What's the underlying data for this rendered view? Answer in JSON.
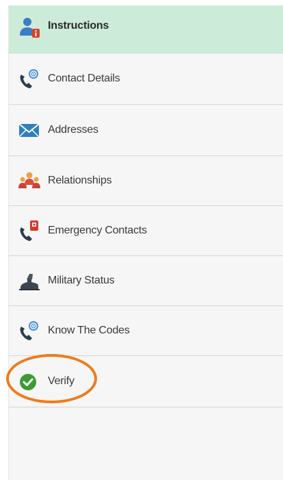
{
  "nav": {
    "items": [
      {
        "label": "Instructions",
        "icon": "user-info-icon",
        "active": true
      },
      {
        "label": "Contact Details",
        "icon": "phone-email-icon",
        "active": false
      },
      {
        "label": "Addresses",
        "icon": "envelope-icon",
        "active": false
      },
      {
        "label": "Relationships",
        "icon": "people-group-icon",
        "active": false
      },
      {
        "label": "Emergency Contacts",
        "icon": "emergency-phone-icon",
        "active": false
      },
      {
        "label": "Military Status",
        "icon": "military-icon",
        "active": false
      },
      {
        "label": "Know The Codes",
        "icon": "phone-email-icon",
        "active": false
      },
      {
        "label": "Verify",
        "icon": "check-circle-icon",
        "active": false
      }
    ]
  },
  "colors": {
    "active_bg": "#ccebd9",
    "highlight_ring": "#f07a1a",
    "check_green": "#3d9a35",
    "icon_blue": "#2f7fc1"
  }
}
